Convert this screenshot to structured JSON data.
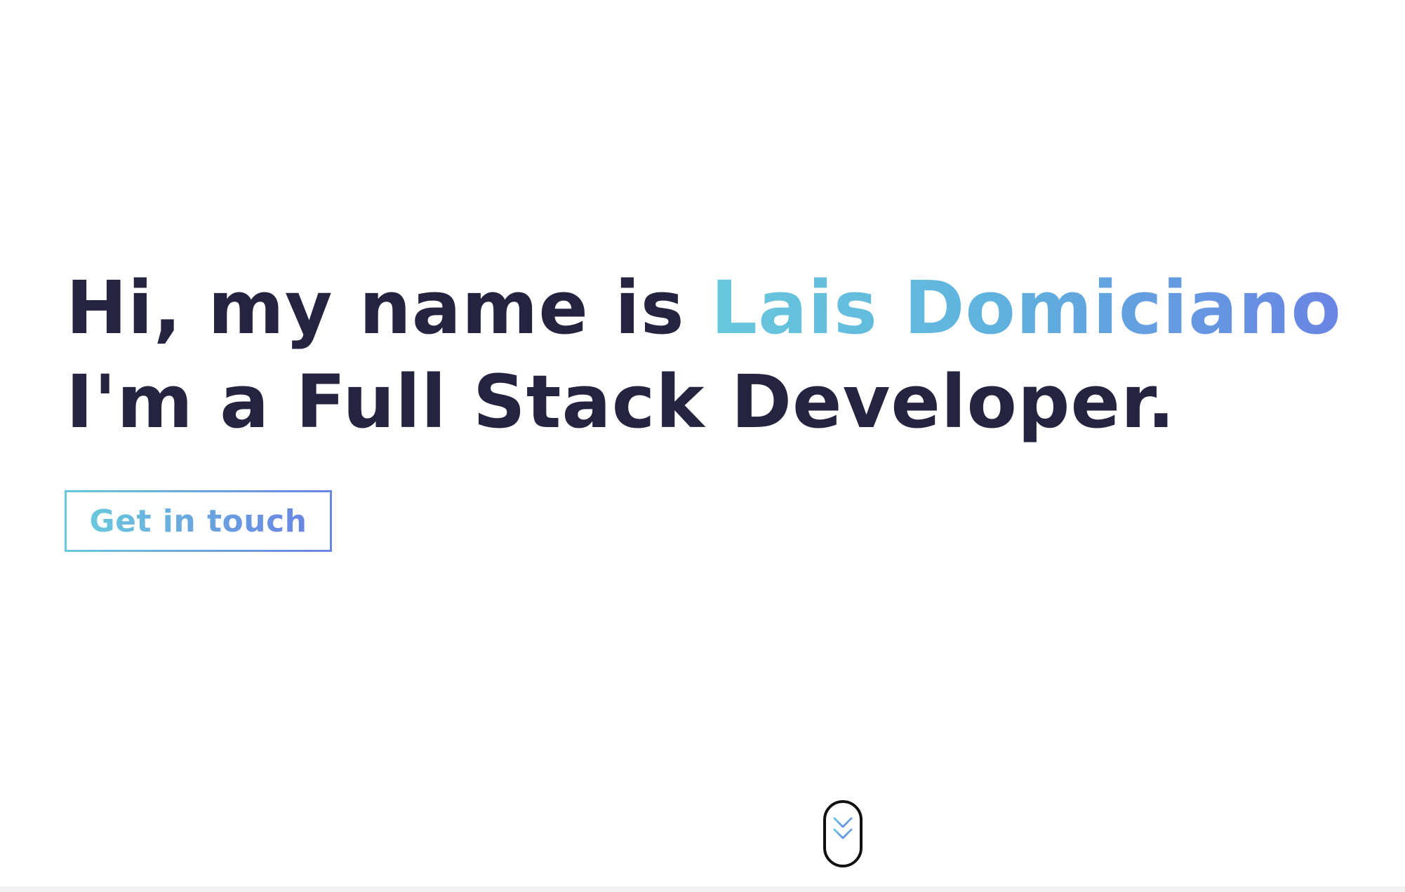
{
  "hero": {
    "greeting": "Hi, my name is ",
    "name": "Lais Domiciano",
    "tagline": "I'm a Full Stack Developer."
  },
  "cta": {
    "label": "Get in touch"
  },
  "scroll_indicator": {
    "icon": "double-chevron-down-icon"
  },
  "colors": {
    "text_dark": "#242340",
    "gradient_start": "#69c8dc",
    "gradient_end": "#6a84e3",
    "background": "#ffffff"
  }
}
